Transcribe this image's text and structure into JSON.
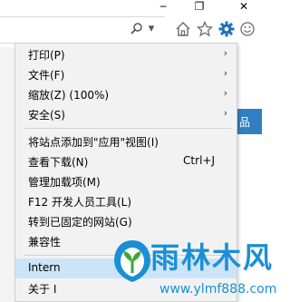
{
  "window": {
    "minimize_glyph": "─",
    "restore_glyph": "❐",
    "close_glyph": "✕"
  },
  "address_bar": {
    "search_glyph": "⚲",
    "dropdown_glyph": "▾"
  },
  "toolbar_icons": [
    "home-icon",
    "favorites-star-icon",
    "tools-gear-icon",
    "feedback-smiley-icon"
  ],
  "page_side_link": "品",
  "menu": {
    "items": [
      {
        "label": "打印(P)",
        "submenu": true
      },
      {
        "label": "文件(F)",
        "submenu": true
      },
      {
        "label": "缩放(Z) (100%)",
        "submenu": true
      },
      {
        "label": "安全(S)",
        "submenu": true
      },
      {
        "label": "将站点添加到\"应用\"视图(I)",
        "submenu": false
      },
      {
        "label": "查看下载(N)",
        "shortcut": "Ctrl+J",
        "submenu": false
      },
      {
        "label": "管理加载项(M)",
        "submenu": false
      },
      {
        "label": "F12 开发人员工具(L)",
        "submenu": false
      },
      {
        "label": "转到已固定的网站(G)",
        "submenu": false
      },
      {
        "label": "兼容性",
        "submenu": false
      },
      {
        "label": "Intern",
        "submenu": false
      },
      {
        "label": "关于 I",
        "submenu": false
      }
    ],
    "submenu_arrow": "›"
  },
  "watermark": {
    "title": "雨林木风",
    "url": "www.ylmf888.com",
    "colors": {
      "blue": "#1a8fd6",
      "green": "#39a935"
    }
  },
  "colors": {
    "menu_bg": "#f2f2f2",
    "highlight": "#cce4f7",
    "accent_gear": "#1e73be"
  }
}
